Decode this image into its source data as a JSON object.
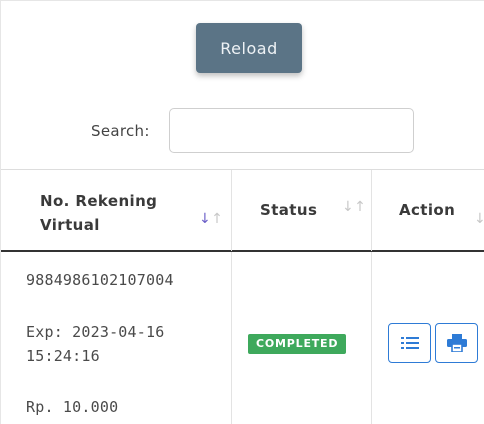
{
  "toolbar": {
    "reload_label": "Reload",
    "search_label": "Search:",
    "search_value": ""
  },
  "table": {
    "columns": [
      {
        "label": "No. Rekening Virtual",
        "sort": "descending"
      },
      {
        "label": "Status",
        "sort": "none"
      },
      {
        "label": "Action",
        "sort": "none"
      }
    ],
    "rows": [
      {
        "va_number": "9884986102107004",
        "exp_line1": "Exp: 2023-04-16",
        "exp_line2": "15:24:16",
        "amount": "Rp. 10.000",
        "status": "COMPLETED",
        "actions": [
          "list-icon",
          "print-icon"
        ]
      }
    ]
  },
  "colors": {
    "reload_button": "#5b7486",
    "status_completed": "#3ea95c",
    "action_accent": "#2e7bd6",
    "sort_active": "#6b5fc8"
  }
}
